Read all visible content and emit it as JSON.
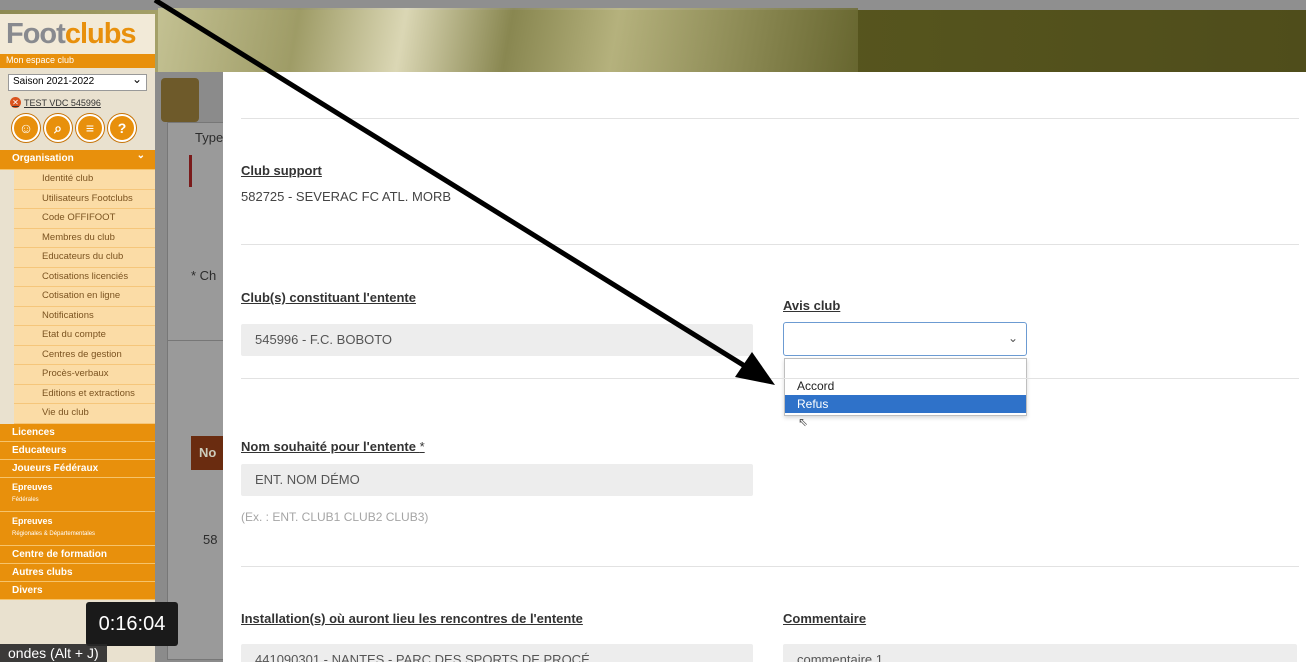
{
  "app": {
    "logo_foot": "Foot",
    "logo_clubs": "clubs",
    "logo_sub": "Mon espace club",
    "season": "Saison 2021-2022",
    "club_id": "TEST VDC 545996",
    "tool_icons": [
      "user-icon",
      "search-icon",
      "document-icon",
      "help-icon"
    ]
  },
  "menu": {
    "organisation": "Organisation",
    "organisation_items": [
      "Identité club",
      "Utilisateurs Footclubs",
      "Code OFFIFOOT",
      "Membres du club",
      "Educateurs du club",
      "Cotisations licenciés",
      "Cotisation en ligne",
      "Notifications",
      "Etat du compte",
      "Centres de gestion",
      "Procès-verbaux",
      "Editions et extractions",
      "Vie du club"
    ],
    "licences": "Licences",
    "educateurs": "Educateurs",
    "joueurs": "Joueurs Fédéraux",
    "epreuves1": "Epreuves",
    "epreuves1_sub": "Fédérales",
    "epreuves2": "Epreuves",
    "epreuves2_sub": "Régionales & Départementales",
    "centre": "Centre de formation",
    "autres": "Autres clubs",
    "divers": "Divers"
  },
  "background_page": {
    "type_label": "Type",
    "ch_label": "* Ch",
    "no_label": "No",
    "num_label": "58"
  },
  "modal": {
    "club_support_label": "Club support",
    "club_support_value": "582725 - SEVERAC FC ATL. MORB",
    "constituent_label": "Club(s) constituant l'entente",
    "constituent_value": "545996 - F.C. BOBOTO",
    "avis_label": "Avis club",
    "avis_value": "",
    "avis_options": [
      "Accord",
      "Refus"
    ],
    "avis_highlighted": "Refus",
    "nom_label": "Nom souhaité pour l'entente",
    "nom_required": "*",
    "nom_value": "ENT. NOM DÉMO",
    "nom_hint": "(Ex. : ENT. CLUB1 CLUB2 CLUB3)",
    "installation_label": "Installation(s) où auront lieu les rencontres de l'entente",
    "installation_value": "441090301 - NANTES - PARC DES SPORTS DE PROCÉ",
    "commentaire_label": "Commentaire",
    "commentaire_value": "commentaire 1"
  },
  "video": {
    "timestamp": "0:16:04",
    "hotkey_hint": "ondes (Alt + J)"
  },
  "colors": {
    "accent": "#e8900c",
    "select_highlight": "#2f72c9",
    "overlay_gray": "#8b8b8b"
  }
}
